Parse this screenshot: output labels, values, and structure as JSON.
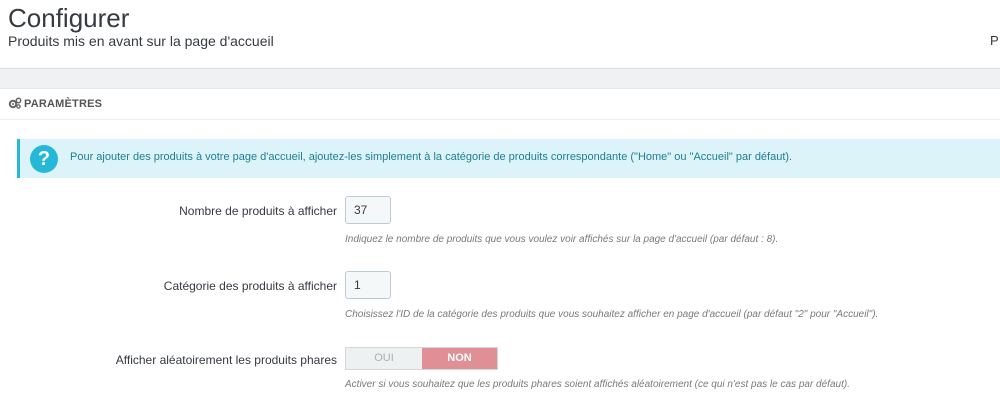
{
  "header": {
    "title": "Configurer",
    "subtitle": "Produits mis en avant sur la page d'accueil",
    "right_cut": "P"
  },
  "panel": {
    "heading_icon": "gears-icon",
    "heading": "PARAMÈTRES",
    "alert": {
      "icon": "question-icon",
      "icon_glyph": "?",
      "text": "Pour ajouter des produits à votre page d'accueil, ajoutez-les simplement à la catégorie de produits correspondante (\"Home\" ou \"Accueil\" par défaut)."
    },
    "fields": [
      {
        "label": "Nombre de produits à afficher",
        "value": "37",
        "help": "Indiquez le nombre de produits que vous voulez voir affichés sur la page d'accueil (par défaut : 8)."
      },
      {
        "label": "Catégorie des produits à afficher",
        "value": "1",
        "help": "Choisissez l'ID de la catégorie des produits que vous souhaitez afficher en page d'accueil (par défaut \"2\" pour \"Accueil\")."
      }
    ],
    "random": {
      "label": "Afficher aléatoirement les produits phares",
      "yes": "OUI",
      "no": "NON",
      "selected": "NON",
      "help": "Activer si vous souhaitez que les produits phares soient affichés aléatoirement (ce qui n'est pas le cas par défaut)."
    }
  },
  "colors": {
    "alert_bg": "#dcf4f9",
    "alert_accent": "#25b9d7",
    "toggle_no_active": "#e08f95"
  }
}
